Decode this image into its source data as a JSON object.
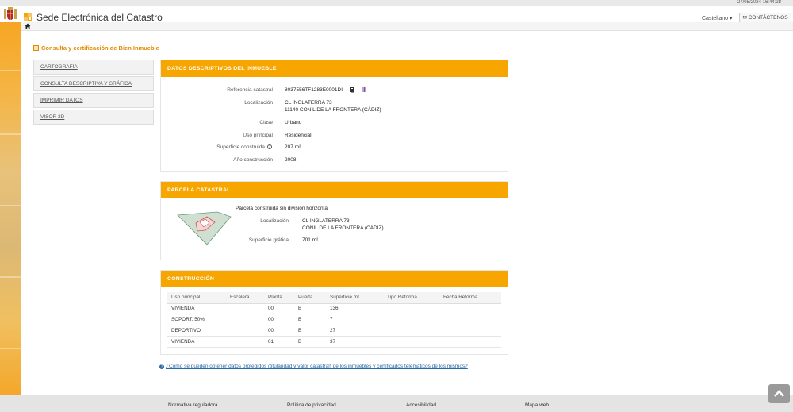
{
  "datetime": "27/05/2024 16:44:28",
  "header": {
    "title": "Sede Electrónica del Catastro",
    "language": "Castellano",
    "contact_label": "CONTÁCTENOS"
  },
  "breadcrumb": "Consulta y certificación de Bien Inmueble",
  "menu": [
    "CARTOGRAFÍA",
    "CONSULTA DESCRIPTIVA Y GRÁFICA",
    "IMPRIMIR DATOS",
    "VISOR 3D"
  ],
  "datos": {
    "title": "DATOS DESCRIPTIVOS DEL INMUEBLE",
    "rows": [
      {
        "label": "Referencia catastral",
        "value": "8037556TF1283E0001DI"
      },
      {
        "label": "Localización",
        "value": "CL INGLATERRA 73",
        "value2": "11140 CONIL DE LA FRONTERA (CÁDIZ)"
      },
      {
        "label": "Clase",
        "value": "Urbano"
      },
      {
        "label": "Uso principal",
        "value": "Residencial"
      },
      {
        "label": "Superficie construida",
        "value": "207 m²"
      },
      {
        "label": "Año construcción",
        "value": "2008"
      }
    ]
  },
  "parcela": {
    "title": "PARCELA CATASTRAL",
    "subtitle": "Parcela construida sin división horizontal",
    "loc_label": "Localización",
    "loc_value": "CL INGLATERRA 73",
    "loc_value2": "CONIL DE LA FRONTERA (CÁDIZ)",
    "sup_label": "Superficie gráfica",
    "sup_value": "701 m²"
  },
  "construccion": {
    "title": "CONSTRUCCIÓN",
    "columns": [
      "Uso principal",
      "Escalera",
      "Planta",
      "Puerta",
      "Superficie m²",
      "Tipo Reforma",
      "Fecha Reforma"
    ],
    "rows": [
      [
        "VIVIENDA",
        "",
        "00",
        "B",
        "136",
        "",
        ""
      ],
      [
        "SOPORT. 50%",
        "",
        "00",
        "B",
        "7",
        "",
        ""
      ],
      [
        "DEPORTIVO",
        "",
        "00",
        "B",
        "27",
        "",
        ""
      ],
      [
        "VIVIENDA",
        "",
        "01",
        "B",
        "37",
        "",
        ""
      ]
    ]
  },
  "faq": "¿Cómo se pueden obtener datos protegidos (titularidad y valor catastral) de los inmuebles y certificados telemáticos de los mismos?",
  "footer": [
    "Normativa reguladora",
    "Política de privacidad",
    "Accesibilidad",
    "Mapa web"
  ],
  "colors": {
    "accent": "#f7a600",
    "link": "#2a6aa3"
  }
}
